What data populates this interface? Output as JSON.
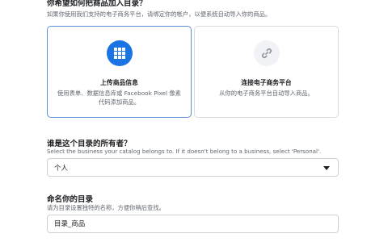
{
  "section_catalog_method": {
    "heading": "你希望如何把商品加入目录？",
    "subtext": "如果你使用我们支持的电子商务平台，请绑定你的帐户，以便系统自动导入你的商品。",
    "options": [
      {
        "icon": "grid-icon",
        "title": "上传商品信息",
        "description": "使用表单、数据信息库或 Facebook Pixel 像素代码添加商品。",
        "selected": true
      },
      {
        "icon": "link-icon",
        "title": "连接电子商务平台",
        "description": "从你的电子商务平台自动导入商品。",
        "selected": false
      }
    ]
  },
  "section_owner": {
    "heading": "谁是这个目录的所有者？",
    "subtext": "Select the business your catalog belongs to. If it doesn't belong to a business, select 'Personal'.",
    "selected_value": "个人"
  },
  "section_name": {
    "heading": "命名你的目录",
    "subtext": "请为目录设置独特的名称，方便你稍后查找。",
    "input_value": "目录_商品"
  },
  "colors": {
    "accent": "#1b74e4",
    "selected_border": "#5b8fd8",
    "border": "#ccd0d5",
    "secondary_text": "#606770"
  }
}
